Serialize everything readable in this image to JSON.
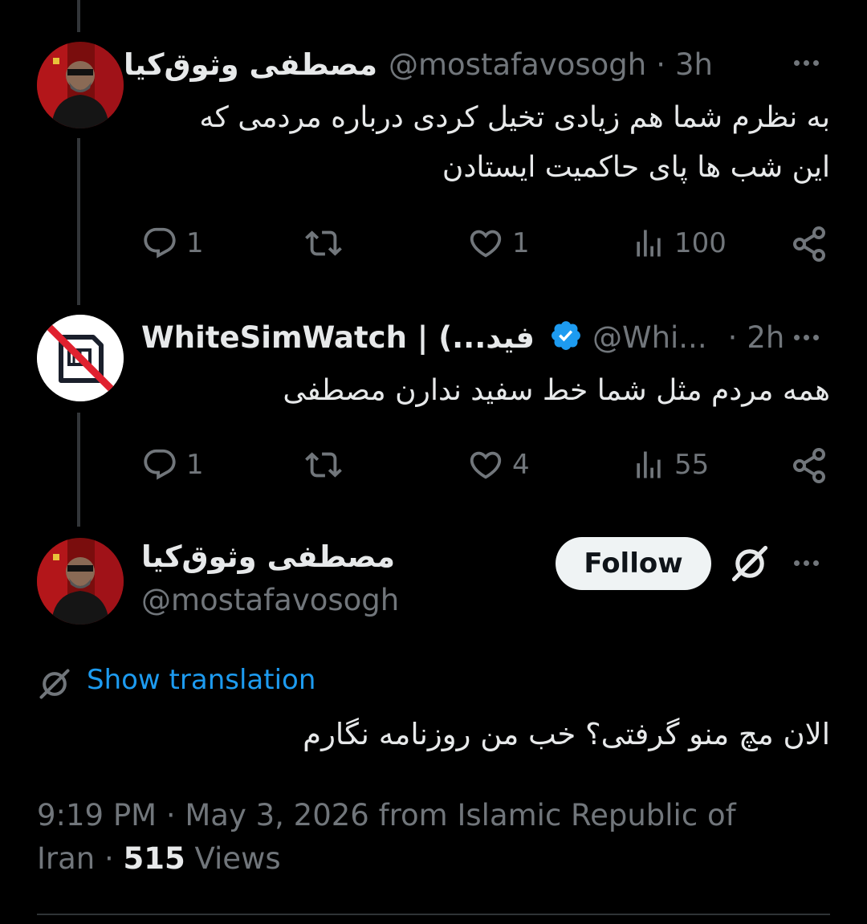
{
  "tweets": [
    {
      "name": "مصطفی وثوق‌کیا",
      "handle": "@mostafavosogh",
      "sep": "·",
      "time": "3h",
      "text_line1": "به نظرم شما هم زیادی تخیل کردی درباره مردمی که",
      "text_line2": "این شب ها پای حاکمیت ایستادن",
      "replies": "1",
      "likes": "1",
      "views": "100"
    },
    {
      "name": "WhiteSimWatch | (...فید",
      "handle": "@Whi...",
      "sep": "·",
      "time": "2h",
      "text_line1": "همه مردم مثل شما خط سفید ندارن مصطفی",
      "replies": "1",
      "likes": "4",
      "views": "55"
    }
  ],
  "main": {
    "name": "مصطفی وثوق‌کیا",
    "handle": "@mostafavosogh",
    "follow_label": "Follow",
    "show_translation": "Show translation",
    "text": "الان مچ منو گرفتی؟ خب من روزنامه نگارم",
    "meta_line1": "9:19 PM · May 3, 2026 from Islamic Republic of",
    "meta_iran": "Iran · ",
    "views_count": "515",
    "views_label": " Views"
  },
  "icons": {
    "reply": "reply-icon",
    "retweet": "retweet-icon",
    "like": "heart-icon",
    "views": "views-icon",
    "share": "share-icon",
    "more": "more-icon",
    "verified": "verified-badge-icon",
    "grok": "grok-icon",
    "translate": "translate-icon"
  },
  "colors": {
    "background": "#000000",
    "link": "#1d9bf0",
    "muted": "#71767b",
    "verified": "#1d9bf0",
    "no_sim_red": "#e0212f"
  }
}
